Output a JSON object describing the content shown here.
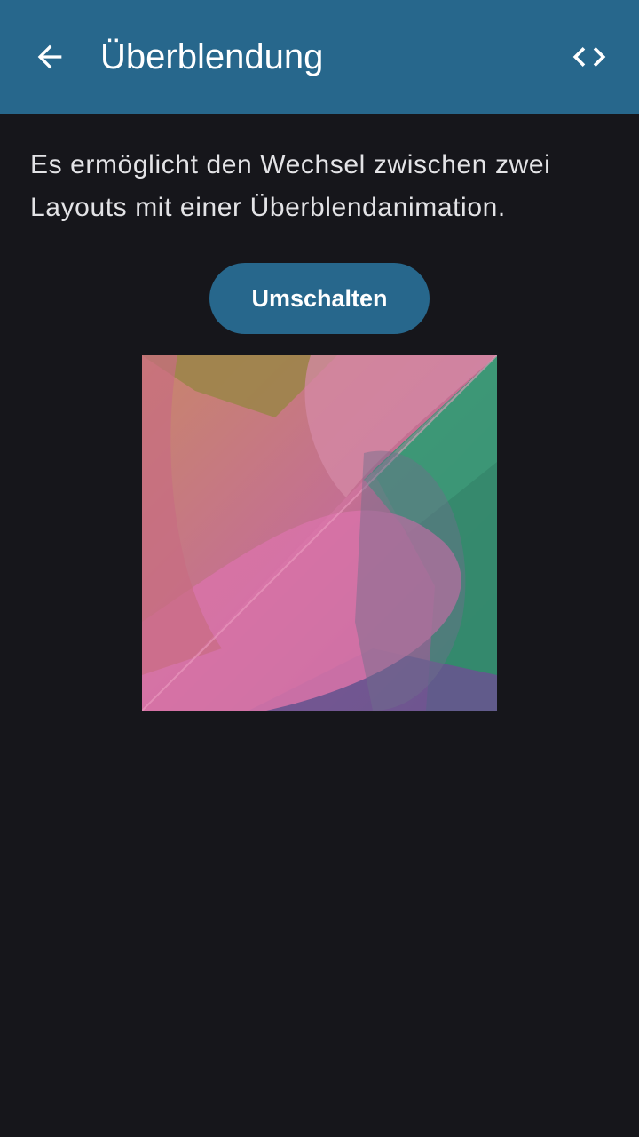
{
  "appbar": {
    "title": "Überblendung",
    "back_icon": "arrow-back-icon",
    "code_icon": "code-icon",
    "background": "#27678c"
  },
  "main": {
    "description": "Es ermöglicht den Wechsel zwischen zwei Layouts mit einer Überblendanimation.",
    "toggle_label": "Umschalten",
    "image_icon": "abstract-gradient-image"
  },
  "colors": {
    "page_background": "#16161b",
    "accent": "#27678c",
    "text": "#e3e3e6"
  }
}
